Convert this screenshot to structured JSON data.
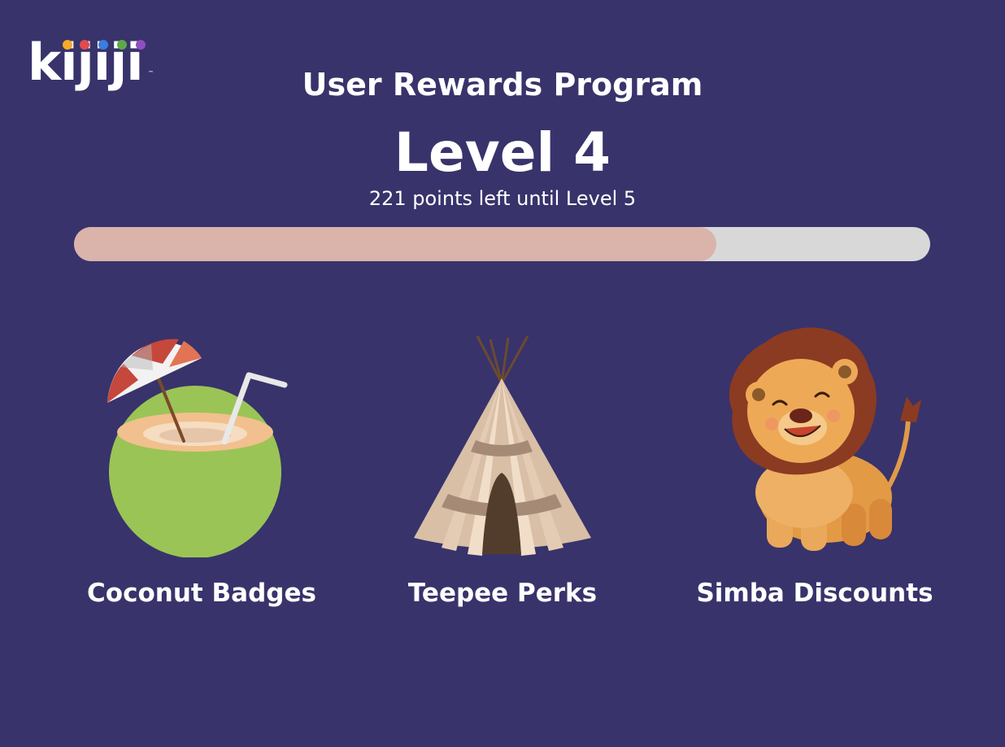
{
  "logo": {
    "text": "kijiji",
    "trademark": "™",
    "dot_colors": [
      "#f7a928",
      "#e34a4f",
      "#3b7de0",
      "#5fa847",
      "#8e4fbf"
    ]
  },
  "header": {
    "program_title": "User Rewards Program",
    "level": "Level 4",
    "points_left": "221 points left until Level 5"
  },
  "progress": {
    "fraction": 0.75,
    "fill_color": "#dab3aa",
    "track_color": "#d8d8d8"
  },
  "rewards": [
    {
      "label": "Coconut Badges",
      "icon": "coconut-drink-icon"
    },
    {
      "label": "Teepee Perks",
      "icon": "teepee-icon"
    },
    {
      "label": "Simba Discounts",
      "icon": "lion-icon"
    }
  ],
  "colors": {
    "background": "#38336b",
    "text": "#ffffff"
  }
}
